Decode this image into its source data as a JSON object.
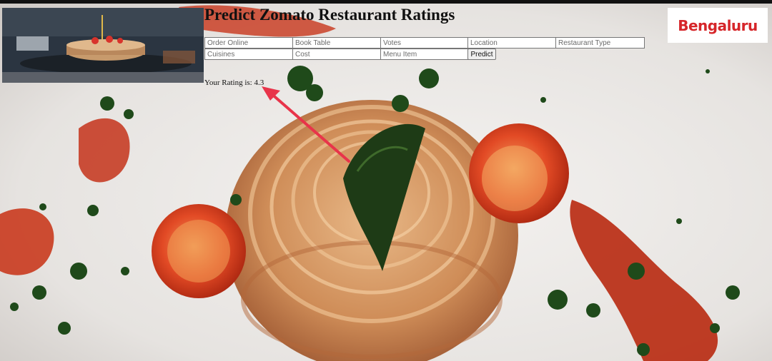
{
  "header": {
    "title": "Predict Zomato Restaurant Ratings",
    "logo_text": "Bengaluru"
  },
  "form": {
    "fields": [
      {
        "name": "order-online",
        "placeholder": "Order Online"
      },
      {
        "name": "book-table",
        "placeholder": "Book Table"
      },
      {
        "name": "votes",
        "placeholder": "Votes"
      },
      {
        "name": "location",
        "placeholder": "Location"
      },
      {
        "name": "restaurant-type",
        "placeholder": "Restaurant Type"
      },
      {
        "name": "cuisines",
        "placeholder": "Cuisines"
      },
      {
        "name": "cost",
        "placeholder": "Cost"
      },
      {
        "name": "menu-item",
        "placeholder": "Menu Item"
      }
    ],
    "predict_label": "Predict"
  },
  "result": {
    "text": "Your Rating is: 4.3"
  },
  "colors": {
    "brand": "#d6262a",
    "annotation_arrow": "#e8344a"
  }
}
